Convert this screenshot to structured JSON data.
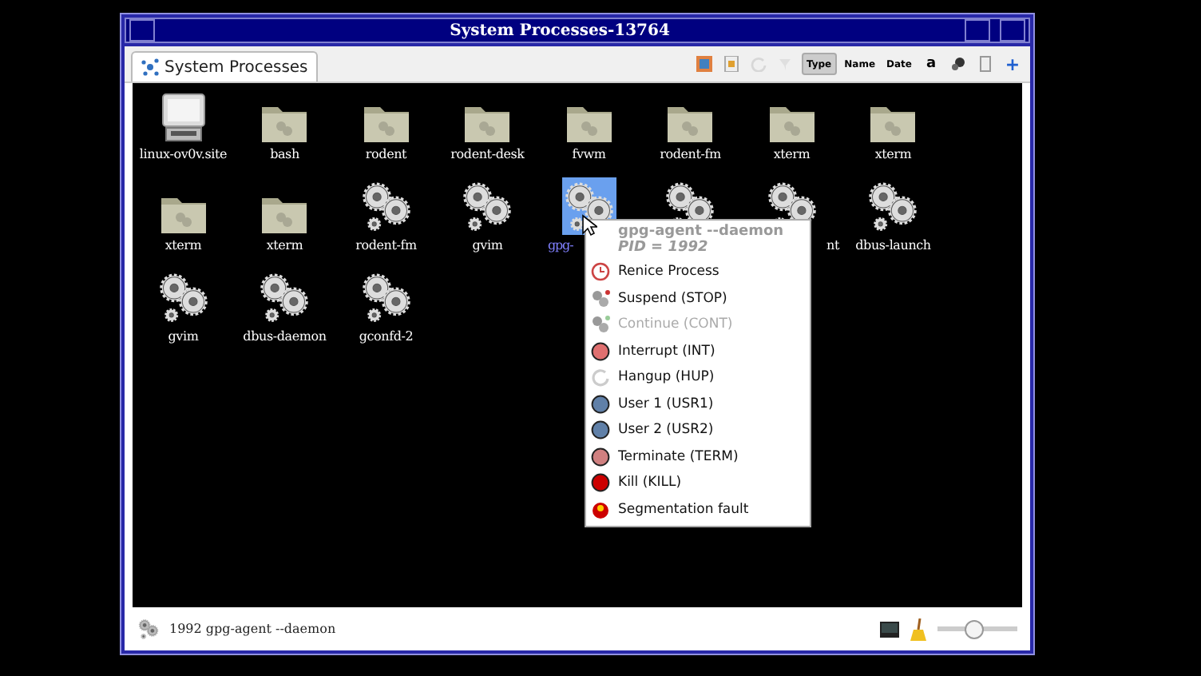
{
  "window": {
    "title": "System Processes-13764"
  },
  "tab": {
    "label": "System Processes",
    "selected": true
  },
  "toolbar": [
    {
      "kind": "icon",
      "disabled": false,
      "selected": false
    },
    {
      "kind": "icon",
      "disabled": false,
      "selected": false
    },
    {
      "kind": "icon",
      "disabled": true,
      "selected": false
    },
    {
      "kind": "icon",
      "disabled": true,
      "selected": false
    },
    {
      "kind": "text",
      "label": "Type",
      "disabled": false,
      "selected": true
    },
    {
      "kind": "text",
      "label": "Name",
      "disabled": false,
      "selected": false
    },
    {
      "kind": "text",
      "label": "Date",
      "disabled": false,
      "selected": false
    },
    {
      "kind": "text",
      "label": "a",
      "disabled": false,
      "selected": false
    },
    {
      "kind": "icon",
      "disabled": false,
      "selected": false
    },
    {
      "kind": "icon",
      "disabled": false,
      "selected": false
    },
    {
      "kind": "text",
      "label": "+",
      "disabled": false,
      "selected": false
    }
  ],
  "icons": [
    {
      "kind": "computer",
      "label": "linux-ov0v.site",
      "selected": false
    },
    {
      "kind": "folder",
      "label": "bash",
      "selected": false
    },
    {
      "kind": "folder",
      "label": "rodent",
      "selected": false
    },
    {
      "kind": "folder",
      "label": "rodent-desk",
      "selected": false
    },
    {
      "kind": "folder",
      "label": "fvwm",
      "selected": false
    },
    {
      "kind": "folder",
      "label": "rodent-fm",
      "selected": false
    },
    {
      "kind": "folder",
      "label": "xterm",
      "selected": false
    },
    {
      "kind": "folder",
      "label": "xterm",
      "selected": false
    },
    {
      "kind": "folder",
      "label": "xterm",
      "selected": false
    },
    {
      "kind": "folder",
      "label": "xterm",
      "selected": false
    },
    {
      "kind": "gears",
      "label": "rodent-fm",
      "selected": false
    },
    {
      "kind": "gears",
      "label": "gvim",
      "selected": false
    },
    {
      "kind": "gears",
      "label": "gpg-",
      "selected": true
    },
    {
      "kind": "gears",
      "selected": false
    },
    {
      "kind": "gears",
      "label": "nt",
      "selected": false
    },
    {
      "kind": "gears",
      "label": "dbus-launch",
      "selected": false
    },
    {
      "kind": "gears",
      "label": "gvim",
      "selected": false
    },
    {
      "kind": "gears",
      "label": "dbus-daemon",
      "selected": false
    },
    {
      "kind": "gears",
      "label": "gconfd-2",
      "selected": false
    }
  ],
  "context_menu": {
    "title": "gpg-agent --daemon",
    "subtitle": "PID = 1992",
    "items": [
      {
        "kind": "clock",
        "label": "Renice Process",
        "disabled": false
      },
      {
        "kind": "gears",
        "label": "Suspend (STOP)",
        "disabled": false
      },
      {
        "kind": "gears",
        "label": "Continue (CONT)",
        "disabled": true
      },
      {
        "kind": "dot",
        "label": "Interrupt (INT)",
        "color": "#e07070",
        "disabled": false
      },
      {
        "kind": "refresh",
        "label": "Hangup (HUP)",
        "disabled": false
      },
      {
        "kind": "dot",
        "label": "User 1 (USR1)",
        "color": "#6080a8",
        "disabled": false
      },
      {
        "kind": "dot",
        "label": "User 2 (USR2)",
        "color": "#6080a8",
        "disabled": false
      },
      {
        "kind": "dot",
        "label": "Terminate (TERM)",
        "color": "#d08080",
        "disabled": false
      },
      {
        "kind": "dot",
        "label": "Kill (KILL)",
        "color": "#cc0000",
        "disabled": false
      },
      {
        "kind": "bomb",
        "label": "Segmentation fault",
        "disabled": false
      }
    ]
  },
  "status_bar": {
    "text": "1992 gpg-agent --daemon",
    "zoom": {
      "level": 0.45
    }
  }
}
